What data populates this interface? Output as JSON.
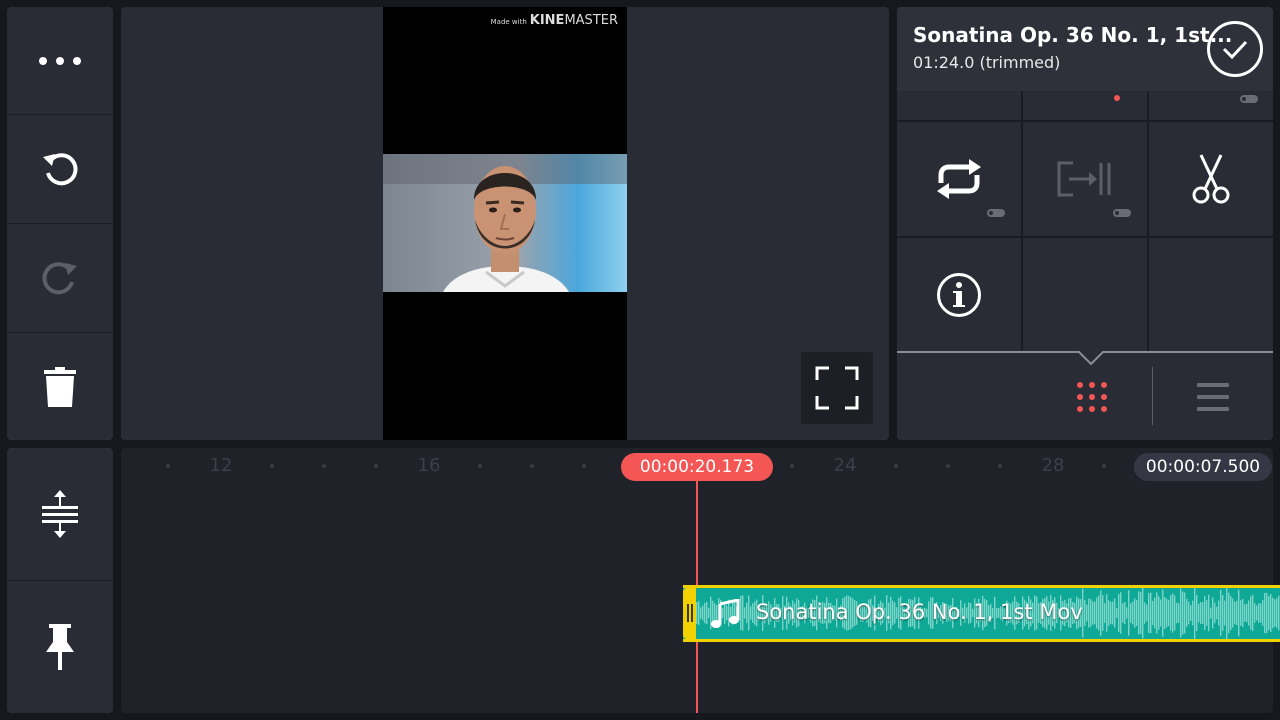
{
  "toolbar": {
    "buttons": [
      {
        "name": "more-button",
        "icon": "more-horizontal-icon"
      },
      {
        "name": "undo-button",
        "icon": "undo-icon"
      },
      {
        "name": "redo-button",
        "icon": "redo-icon",
        "disabled": true
      },
      {
        "name": "delete-button",
        "icon": "trash-icon"
      }
    ]
  },
  "preview": {
    "watermark_small": "Made with",
    "watermark_brand": "KINE",
    "watermark_brand2": "MASTER",
    "fullscreen_icon": "fullscreen-icon"
  },
  "clip_panel": {
    "title": "Sonatina Op. 36 No. 1, 1st...",
    "subtitle": "01:24.0 (trimmed)",
    "confirm_icon": "check-circle-icon",
    "tools": [
      {
        "name": "loop-button",
        "icon": "loop-icon",
        "has_toggle": true
      },
      {
        "name": "extend-button",
        "icon": "extend-to-end-icon",
        "has_toggle": true,
        "disabled": true
      },
      {
        "name": "split-button",
        "icon": "scissors-icon"
      },
      {
        "name": "info-button",
        "icon": "info-icon"
      }
    ],
    "tabs": [
      {
        "name": "tab-grid",
        "icon": "grid-dots-icon",
        "active": true
      },
      {
        "name": "tab-list",
        "icon": "list-icon",
        "active": false
      }
    ],
    "colors": {
      "accent": "#f35654",
      "active_tab": "#f35654"
    }
  },
  "timeline_tools": [
    {
      "name": "expand-timeline-button",
      "icon": "expand-vertical-icon"
    },
    {
      "name": "pin-button",
      "icon": "pin-icon"
    }
  ],
  "timeline": {
    "ruler_labels": [
      "12",
      "16",
      "24",
      "28"
    ],
    "playhead_time": "00:00:20.173",
    "duration": "00:00:07.500",
    "audio_clip": {
      "label": "Sonatina Op. 36 No. 1, 1st Mov",
      "icon": "music-note-icon",
      "color": "#0fa896",
      "selected_border": "#f2d100"
    }
  }
}
